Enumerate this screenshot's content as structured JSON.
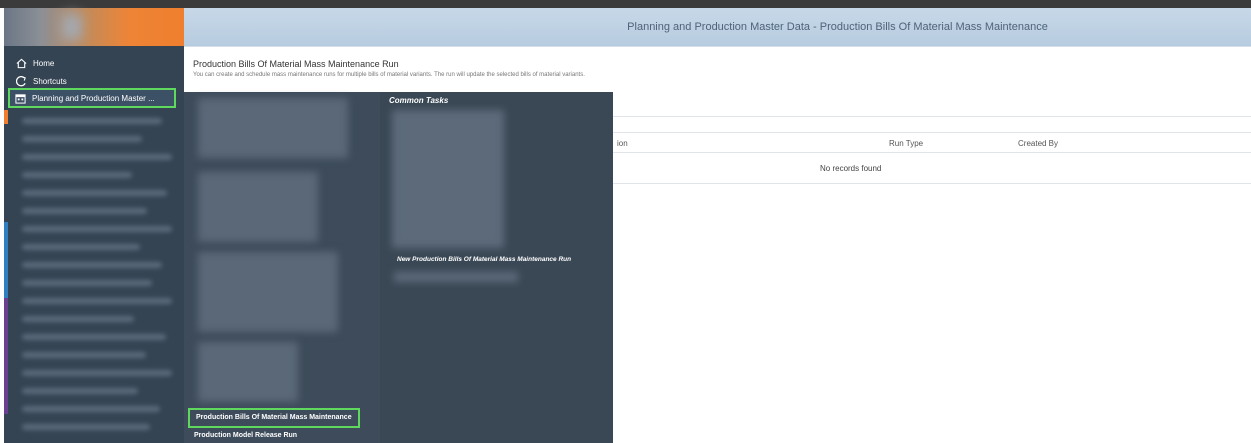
{
  "header": {
    "title": "Planning and Production Master Data - Production Bills Of Material Mass Maintenance"
  },
  "sidebar": {
    "items": [
      {
        "label": "Home",
        "icon": "home-icon"
      },
      {
        "label": "Shortcuts",
        "icon": "shortcut-icon"
      },
      {
        "label": "Planning and Production Master ...",
        "icon": "calendar-icon",
        "active": true
      }
    ]
  },
  "content": {
    "title": "Production Bills Of Material Mass Maintenance Run",
    "description": "You can create and schedule mass maintenance runs for multiple bills of material variants. The run will update the selected bills of material variants.",
    "table": {
      "columns": [
        "ion",
        "Run Type",
        "Created By"
      ],
      "empty_text": "No records found"
    }
  },
  "menu": {
    "common_tasks_heading": "Common Tasks",
    "common_task_link": "New Production Bills Of Material Mass Maintenance Run",
    "items": [
      "Production Bills Of Material Mass Maintenance",
      "Production Model Release Run"
    ]
  },
  "colors": {
    "header_bg": "#c0d3e6",
    "rail_bg": "#354453",
    "menu_bg": "#3d4b5a",
    "highlight": "#5ed95e",
    "accent_orange": "#ef7f2e"
  }
}
